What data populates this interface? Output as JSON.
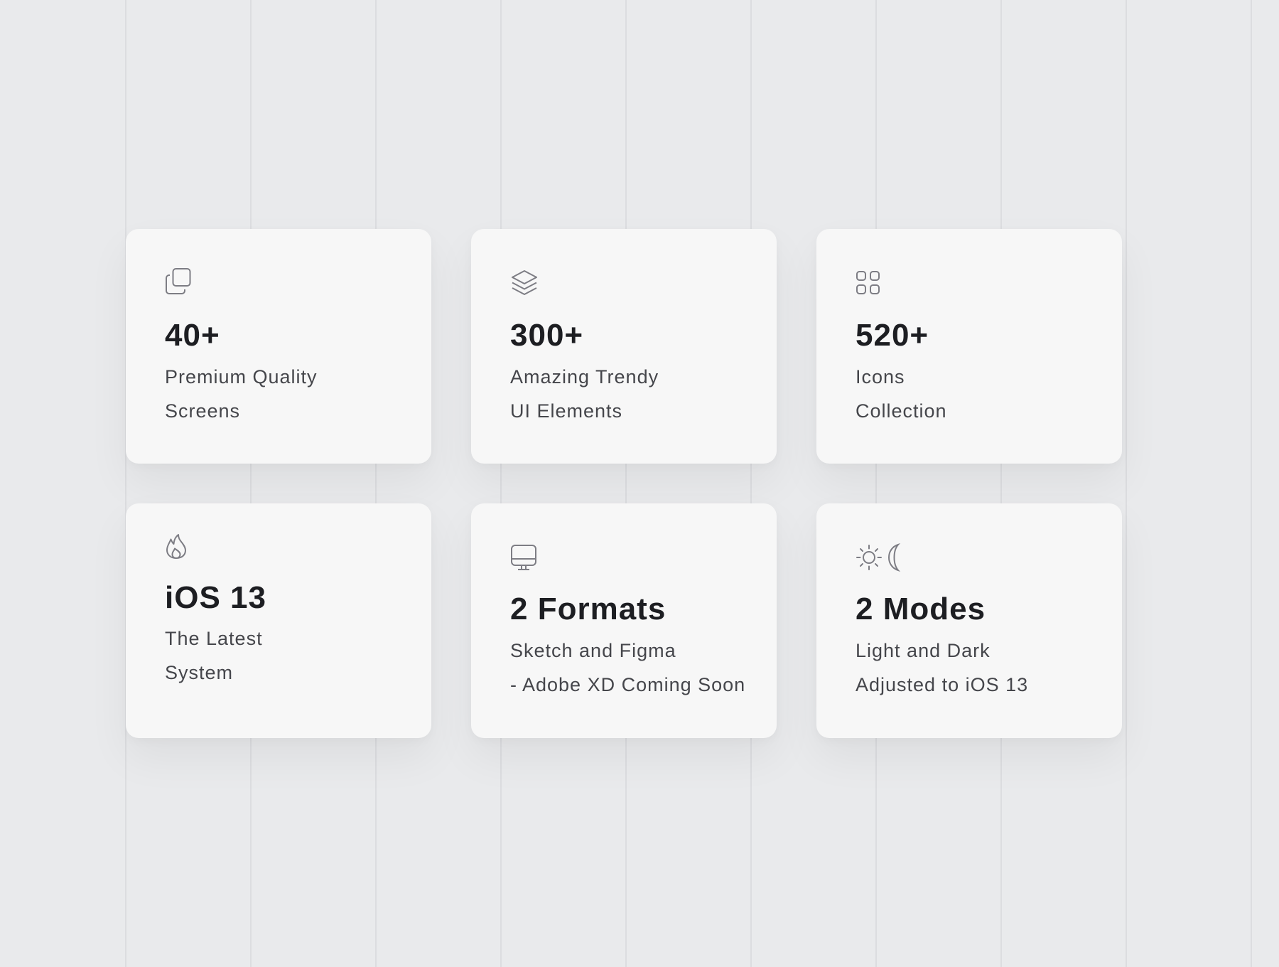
{
  "cards": [
    {
      "icon": "copy-icon",
      "value": "40+",
      "line1": "Premium Quality",
      "line2": "Screens"
    },
    {
      "icon": "layers-icon",
      "value": "300+",
      "line1": "Amazing Trendy",
      "line2": "UI Elements"
    },
    {
      "icon": "grid-icon",
      "value": "520+",
      "line1": "Icons",
      "line2": "Collection"
    },
    {
      "icon": "flame-icon",
      "value": "iOS 13",
      "line1": "The Latest",
      "line2": "System"
    },
    {
      "icon": "monitor-icon",
      "value": "2 Formats",
      "line1": "Sketch and Figma",
      "line2": "- Adobe XD Coming Soon"
    },
    {
      "icon": "sun-moon-icon",
      "value": "2 Modes",
      "line1": "Light and Dark",
      "line2": "Adjusted to iOS 13"
    }
  ],
  "colors": {
    "background": "#e9eaec",
    "card": "#f7f7f7",
    "heading": "#1d1e22",
    "body_text": "#45464b",
    "icon": "#7d7d84",
    "grid_line": "#dcdde0"
  }
}
